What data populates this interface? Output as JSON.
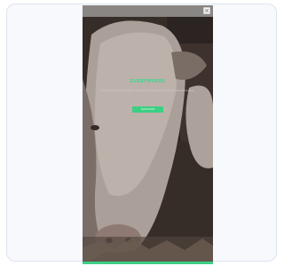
{
  "preview": {
    "headline": "EVERYWHERE",
    "subtext": "Lorem ipsum dolor sit amet, consectetur adipiscing elit sed do eiusmod tempor",
    "cta_label": "SHOP NOW"
  },
  "icons": {
    "close": "close-icon"
  },
  "colors": {
    "accent": "#3ccf84",
    "card_bg": "#f7f9fc",
    "topbar": "#8a8683"
  }
}
